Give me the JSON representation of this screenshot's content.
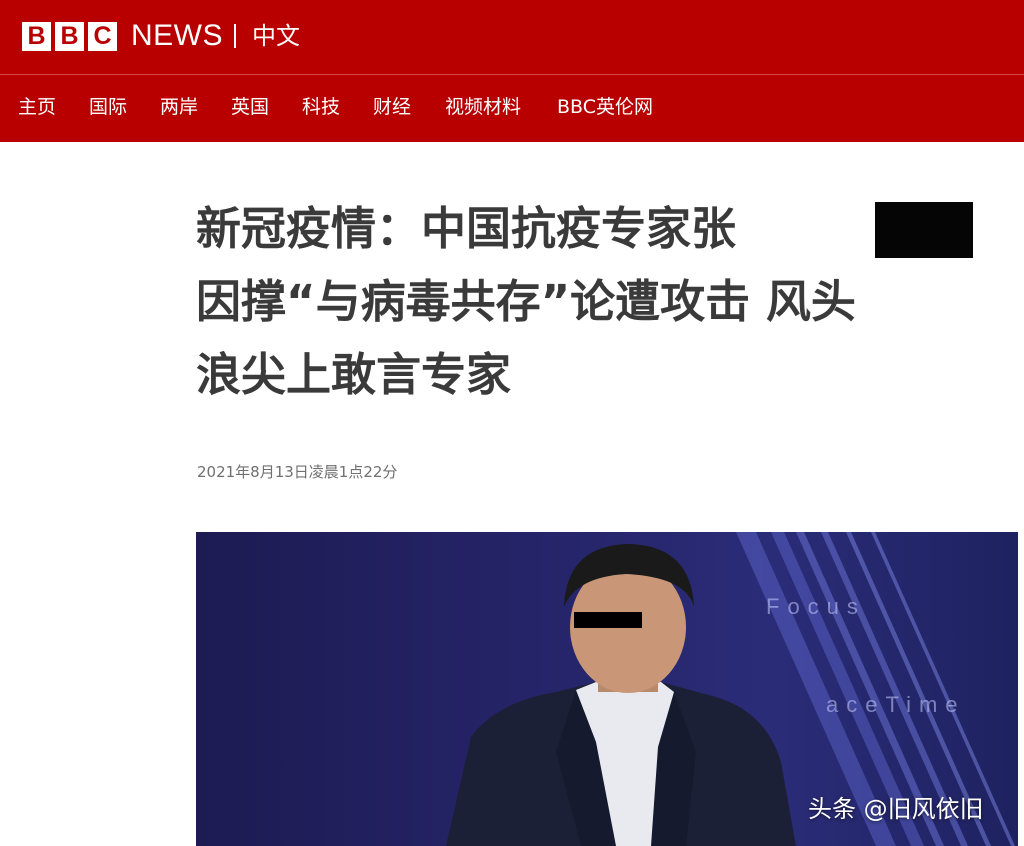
{
  "header": {
    "brand_letters": [
      "B",
      "B",
      "C"
    ],
    "brand_news": "NEWS",
    "edition": "中文",
    "brand_color": "#b80000"
  },
  "nav": {
    "items": [
      "主页",
      "国际",
      "两岸",
      "英国",
      "科技",
      "财经",
      "视频材料",
      "BBC英伦网"
    ]
  },
  "article": {
    "headline_line1": "新冠疫情：中国抗疫专家张",
    "headline_line2": "因撑“与病毒共存”论遭攻击 风头",
    "headline_line3": "浪尖上敢言专家",
    "date": "2021年8月13日凌晨1点22分"
  },
  "photo": {
    "background_words": [
      "Focus",
      "aceTime"
    ]
  },
  "watermark": "头条 @旧风依旧"
}
